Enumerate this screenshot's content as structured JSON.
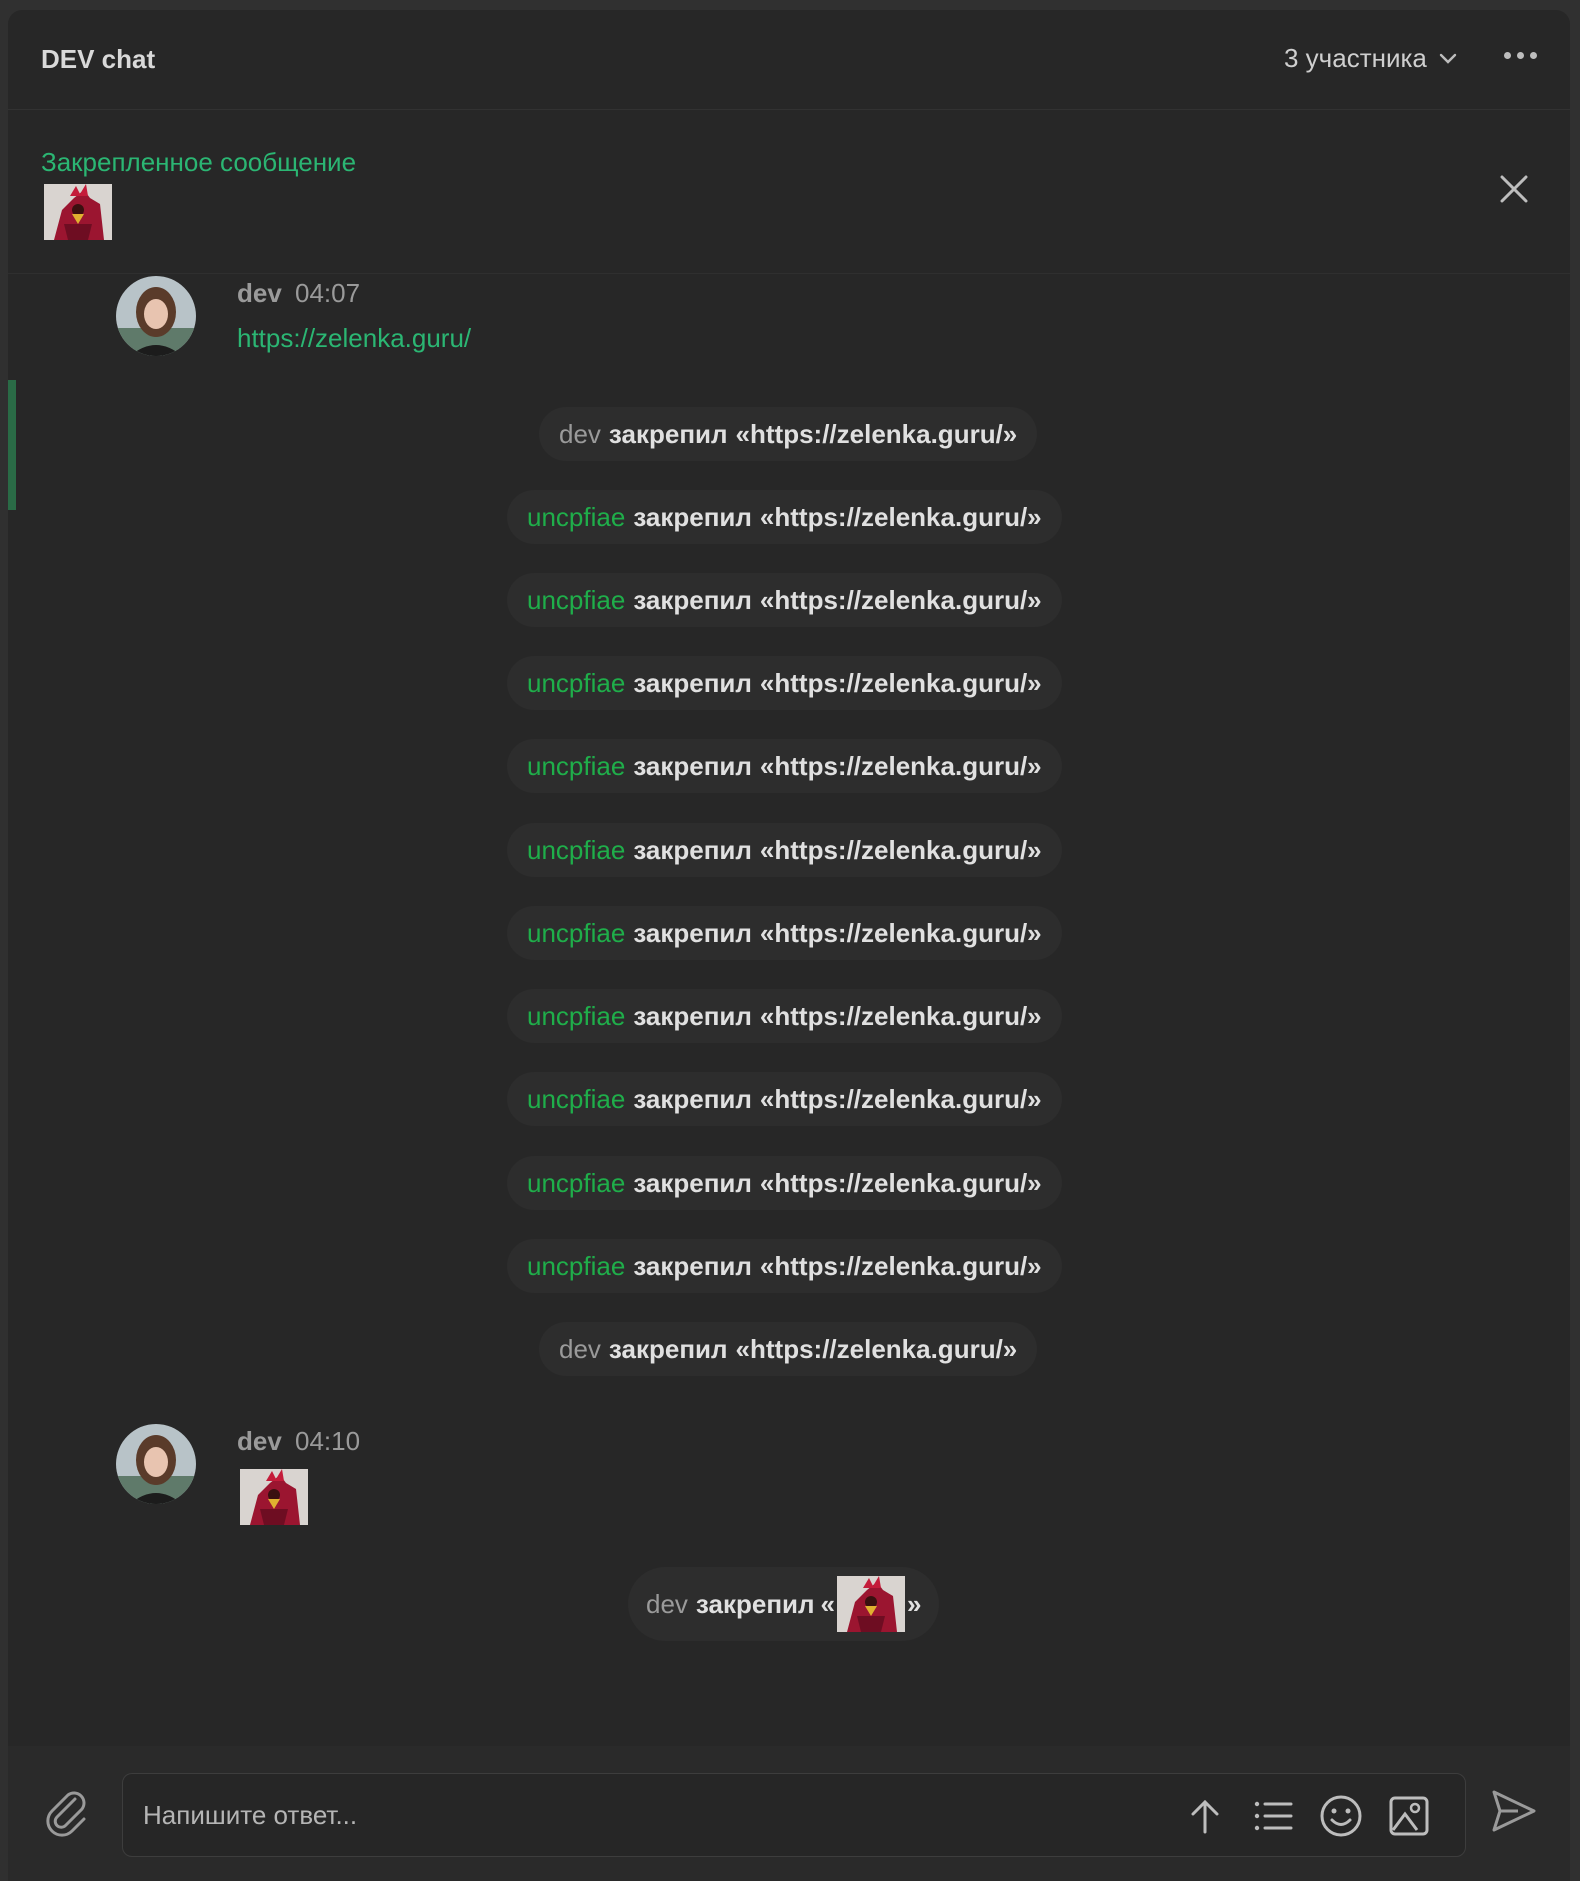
{
  "header": {
    "title": "DEV chat",
    "participants_label": "3 участника",
    "more_icon": "more-horizontal-icon",
    "chevron_icon": "chevron-down-icon"
  },
  "pinned": {
    "title": "Закрепленное сообщение",
    "thumbnail": "rooster-image",
    "close_icon": "close-icon"
  },
  "messages": [
    {
      "author": "dev",
      "time": "04:07",
      "link": "https://zelenka.guru/"
    },
    {
      "author": "dev",
      "time": "04:10",
      "image": "rooster-image"
    }
  ],
  "system_messages": [
    {
      "who": "dev",
      "action": "закрепил",
      "text": "«https://zelenka.guru/»"
    },
    {
      "who": "uncpfiae",
      "action": "закрепил",
      "text": "«https://zelenka.guru/»"
    },
    {
      "who": "uncpfiae",
      "action": "закрепил",
      "text": "«https://zelenka.guru/»"
    },
    {
      "who": "uncpfiae",
      "action": "закрепил",
      "text": "«https://zelenka.guru/»"
    },
    {
      "who": "uncpfiae",
      "action": "закрепил",
      "text": "«https://zelenka.guru/»"
    },
    {
      "who": "uncpfiae",
      "action": "закрепил",
      "text": "«https://zelenka.guru/»"
    },
    {
      "who": "uncpfiae",
      "action": "закрепил",
      "text": "«https://zelenka.guru/»"
    },
    {
      "who": "uncpfiae",
      "action": "закрепил",
      "text": "«https://zelenka.guru/»"
    },
    {
      "who": "uncpfiae",
      "action": "закрепил",
      "text": "«https://zelenka.guru/»"
    },
    {
      "who": "uncpfiae",
      "action": "закрепил",
      "text": "«https://zelenka.guru/»"
    },
    {
      "who": "uncpfiae",
      "action": "закрепил",
      "text": "«https://zelenka.guru/»"
    },
    {
      "who": "dev",
      "action": "закрепил",
      "text": "«https://zelenka.guru/»"
    }
  ],
  "last_system": {
    "who": "dev",
    "action": "закрепил",
    "open": "«",
    "close": "»",
    "image": "rooster-image"
  },
  "composer": {
    "placeholder": "Напишите ответ...",
    "icons": [
      "attach-icon",
      "arrow-up-icon",
      "list-icon",
      "emoji-icon",
      "image-icon",
      "send-icon"
    ]
  },
  "colors": {
    "accent_green": "#2bb673",
    "user_green": "#1fae4a",
    "background": "#272727"
  }
}
